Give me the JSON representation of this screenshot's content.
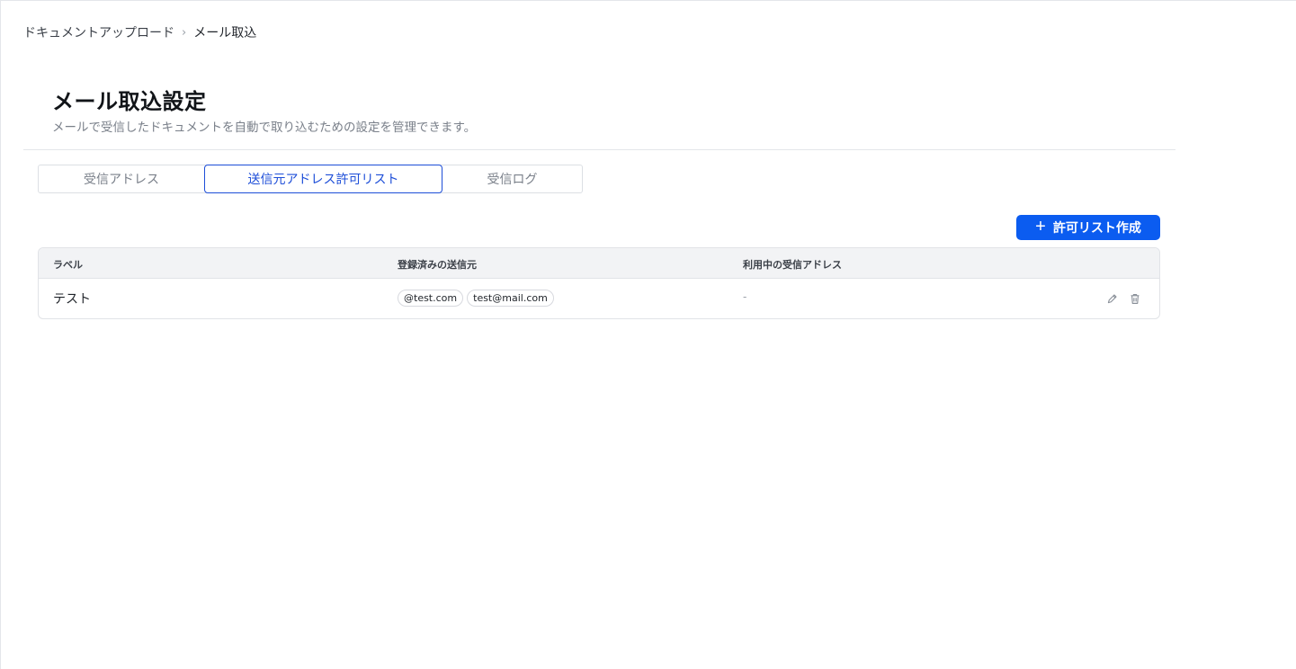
{
  "breadcrumb": {
    "items": [
      "ドキュメントアップロード",
      "メール取込"
    ],
    "separator": "›"
  },
  "page": {
    "title": "メール取込設定",
    "subtitle": "メールで受信したドキュメントを自動で取り込むための設定を管理できます。"
  },
  "tabs": [
    {
      "label": "受信アドレス",
      "active": false
    },
    {
      "label": "送信元アドレス許可リスト",
      "active": true
    },
    {
      "label": "受信ログ",
      "active": false
    }
  ],
  "toolbar": {
    "create_label": "許可リスト作成",
    "create_icon": "plus-icon"
  },
  "table": {
    "columns": [
      "ラベル",
      "登録済みの送信元",
      "利用中の受信アドレス"
    ],
    "rows": [
      {
        "label": "テスト",
        "senders": [
          "@test.com",
          "test@mail.com"
        ],
        "receive_address": "-",
        "actions": [
          "edit-icon",
          "trash-icon"
        ]
      }
    ]
  },
  "colors": {
    "accent": "#0b5cf0",
    "active_tab": "#1d4ed8",
    "header_bg": "#f2f3f5"
  }
}
